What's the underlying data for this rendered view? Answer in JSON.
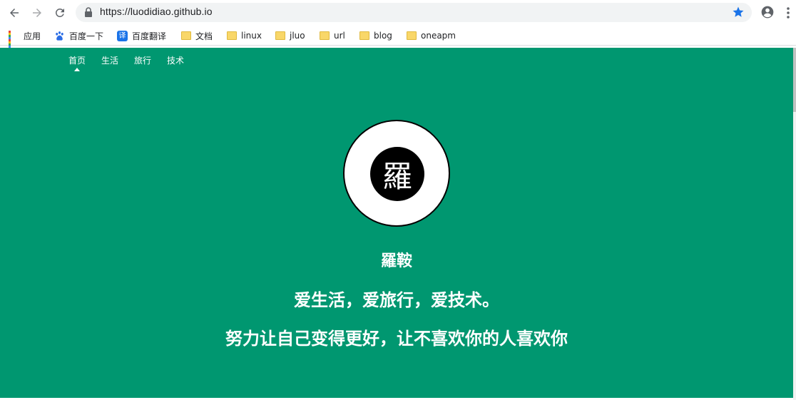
{
  "browser": {
    "url": "https://luodidiao.github.io",
    "bookmarks": [
      {
        "label": "应用",
        "icon": "apps-grid-icon"
      },
      {
        "label": "百度一下",
        "icon": "baidu-paw-icon"
      },
      {
        "label": "百度翻译",
        "icon": "translate-icon",
        "icon_text": "译"
      },
      {
        "label": "文档",
        "icon": "folder-icon"
      },
      {
        "label": "linux",
        "icon": "folder-icon"
      },
      {
        "label": "jluo",
        "icon": "folder-icon"
      },
      {
        "label": "url",
        "icon": "folder-icon"
      },
      {
        "label": "blog",
        "icon": "folder-icon"
      },
      {
        "label": "oneapm",
        "icon": "folder-icon"
      }
    ]
  },
  "site": {
    "nav": [
      {
        "label": "首页",
        "active": true
      },
      {
        "label": "生活",
        "active": false
      },
      {
        "label": "旅行",
        "active": false
      },
      {
        "label": "技术",
        "active": false
      }
    ],
    "avatar_char": "羅",
    "name": "羅鞍",
    "motto": "爱生活，爱旅行，爱技术。",
    "slogan": "努力让自己变得更好，让不喜欢你的人喜欢你"
  },
  "colors": {
    "hero_bg": "#009770",
    "star": "#1a73e8"
  }
}
